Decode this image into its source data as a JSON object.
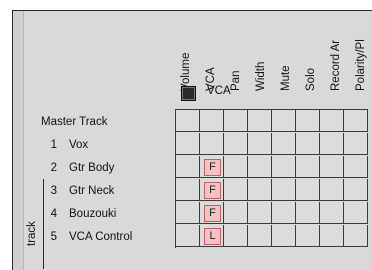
{
  "matrix": {
    "columns": [
      "Volume",
      "VCA",
      "Pan",
      "Width",
      "Mute",
      "Solo",
      "Record Ar",
      "Polarity/Pl"
    ],
    "vca_group_label": "VCA",
    "axis_label": "track",
    "rows": [
      {
        "num": "",
        "name": "Master Track",
        "flags": [
          "",
          "",
          "",
          "",
          "",
          "",
          "",
          ""
        ]
      },
      {
        "num": "1",
        "name": "Vox",
        "flags": [
          "",
          "",
          "",
          "",
          "",
          "",
          "",
          ""
        ]
      },
      {
        "num": "2",
        "name": "Gtr Body",
        "flags": [
          "",
          "F",
          "",
          "",
          "",
          "",
          "",
          ""
        ]
      },
      {
        "num": "3",
        "name": "Gtr Neck",
        "flags": [
          "",
          "F",
          "",
          "",
          "",
          "",
          "",
          ""
        ]
      },
      {
        "num": "4",
        "name": "Bouzouki",
        "flags": [
          "",
          "F",
          "",
          "",
          "",
          "",
          "",
          ""
        ]
      },
      {
        "num": "5",
        "name": "VCA Control",
        "flags": [
          "",
          "L",
          "",
          "",
          "",
          "",
          "",
          ""
        ]
      }
    ]
  },
  "colors": {
    "panel_bg": "#d9d9d9",
    "flag_fill": "#f3c2c2",
    "flag_border": "#c06060"
  }
}
